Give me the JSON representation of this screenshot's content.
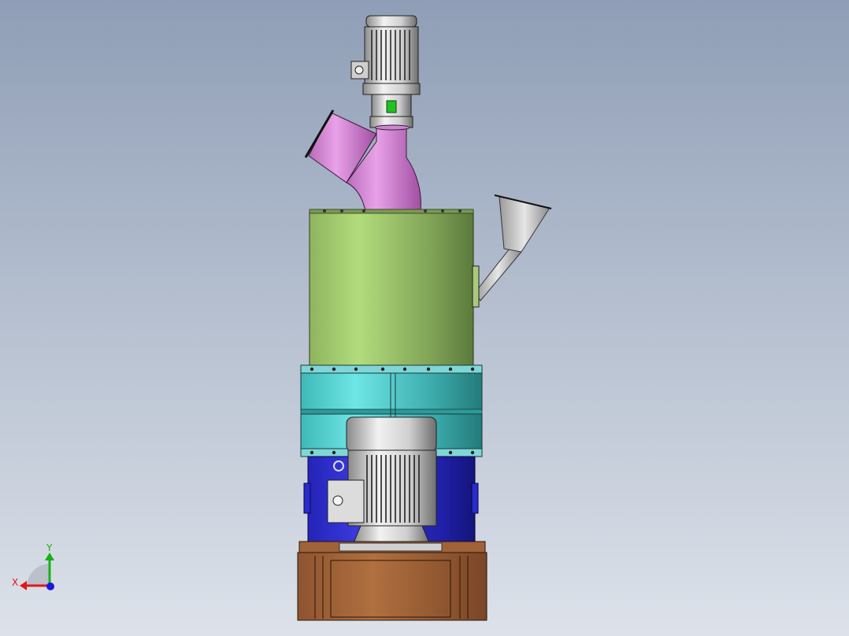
{
  "viewport": {
    "background_top": "#8f9eb6",
    "background_bottom": "#dde2ea"
  },
  "model": {
    "parts": [
      {
        "name": "top-motor",
        "color": "#d9d9d9"
      },
      {
        "name": "inlet-elbow",
        "color": "#d98bd9"
      },
      {
        "name": "classifier-cylinder",
        "color": "#a9d07a"
      },
      {
        "name": "feed-chute",
        "color": "#bfbfbf"
      },
      {
        "name": "grinding-chamber",
        "color": "#5ed6d6"
      },
      {
        "name": "lower-chamber",
        "color": "#2f2fd0"
      },
      {
        "name": "main-motor",
        "color": "#d9d9d9"
      },
      {
        "name": "gearbox-base",
        "color": "#a8673e"
      }
    ]
  },
  "triad": {
    "x_label": "X",
    "y_label": "Y",
    "x_color": "#e01818",
    "y_color": "#18b018",
    "z_color": "#1818e0"
  }
}
